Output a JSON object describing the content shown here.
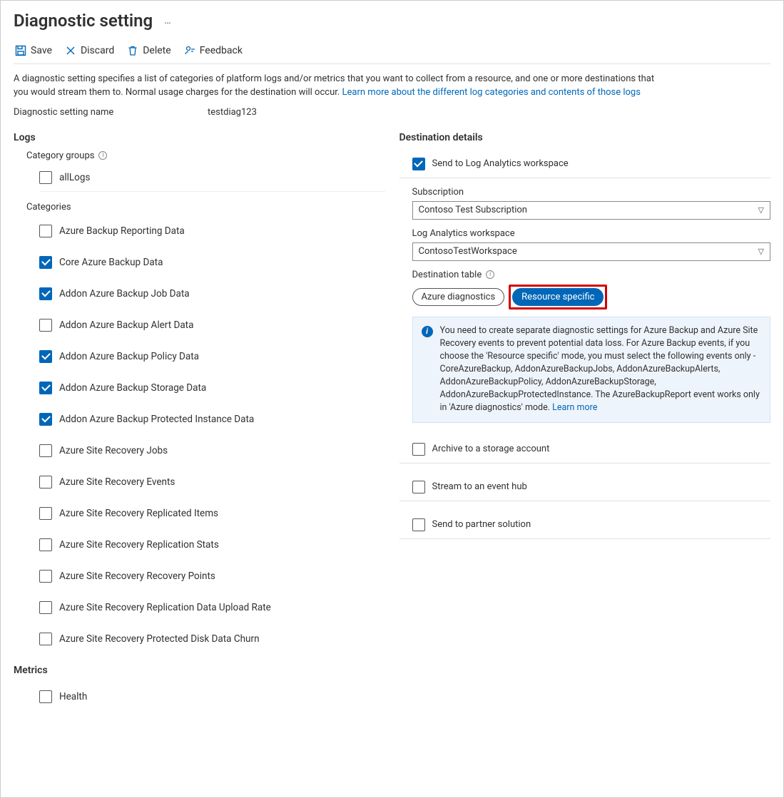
{
  "page": {
    "title": "Diagnostic setting",
    "more": "…"
  },
  "toolbar": {
    "save": "Save",
    "discard": "Discard",
    "delete": "Delete",
    "feedback": "Feedback"
  },
  "intro": {
    "text": "A diagnostic setting specifies a list of categories of platform logs and/or metrics that you want to collect from a resource, and one or more destinations that you would stream them to. Normal usage charges for the destination will occur. ",
    "link": "Learn more about the different log categories and contents of those logs"
  },
  "name_field": {
    "label": "Diagnostic setting name",
    "value": "testdiag123"
  },
  "logs": {
    "heading": "Logs",
    "category_groups_label": "Category groups",
    "groups": [
      {
        "label": "allLogs",
        "checked": false
      }
    ],
    "categories_label": "Categories",
    "categories": [
      {
        "label": "Azure Backup Reporting Data",
        "checked": false
      },
      {
        "label": "Core Azure Backup Data",
        "checked": true
      },
      {
        "label": "Addon Azure Backup Job Data",
        "checked": true
      },
      {
        "label": "Addon Azure Backup Alert Data",
        "checked": false
      },
      {
        "label": "Addon Azure Backup Policy Data",
        "checked": true
      },
      {
        "label": "Addon Azure Backup Storage Data",
        "checked": true
      },
      {
        "label": "Addon Azure Backup Protected Instance Data",
        "checked": true
      },
      {
        "label": "Azure Site Recovery Jobs",
        "checked": false
      },
      {
        "label": "Azure Site Recovery Events",
        "checked": false
      },
      {
        "label": "Azure Site Recovery Replicated Items",
        "checked": false
      },
      {
        "label": "Azure Site Recovery Replication Stats",
        "checked": false
      },
      {
        "label": "Azure Site Recovery Recovery Points",
        "checked": false
      },
      {
        "label": "Azure Site Recovery Replication Data Upload Rate",
        "checked": false
      },
      {
        "label": "Azure Site Recovery Protected Disk Data Churn",
        "checked": false
      }
    ]
  },
  "metrics": {
    "heading": "Metrics",
    "items": [
      {
        "label": "Health",
        "checked": false
      }
    ]
  },
  "dest": {
    "heading": "Destination details",
    "send_la": {
      "label": "Send to Log Analytics workspace",
      "checked": true
    },
    "subscription": {
      "label": "Subscription",
      "value": "Contoso Test Subscription"
    },
    "workspace": {
      "label": "Log Analytics workspace",
      "value": "ContosoTestWorkspace"
    },
    "dest_table_label": "Destination table",
    "toggle": {
      "azure_diag": "Azure diagnostics",
      "resource_specific": "Resource specific",
      "selected": "resource_specific"
    },
    "info": {
      "text": "You need to create separate diagnostic settings for Azure Backup and Azure Site Recovery events to prevent potential data loss. For Azure Backup events, if you choose the 'Resource specific' mode, you must select the following events only - CoreAzureBackup, AddonAzureBackupJobs, AddonAzureBackupAlerts, AddonAzureBackupPolicy, AddonAzureBackupStorage, AddonAzureBackupProtectedInstance. The AzureBackupReport event works only in 'Azure diagnostics' mode.  ",
      "link": "Learn more"
    },
    "archive": {
      "label": "Archive to a storage account",
      "checked": false
    },
    "eventhub": {
      "label": "Stream to an event hub",
      "checked": false
    },
    "partner": {
      "label": "Send to partner solution",
      "checked": false
    }
  }
}
